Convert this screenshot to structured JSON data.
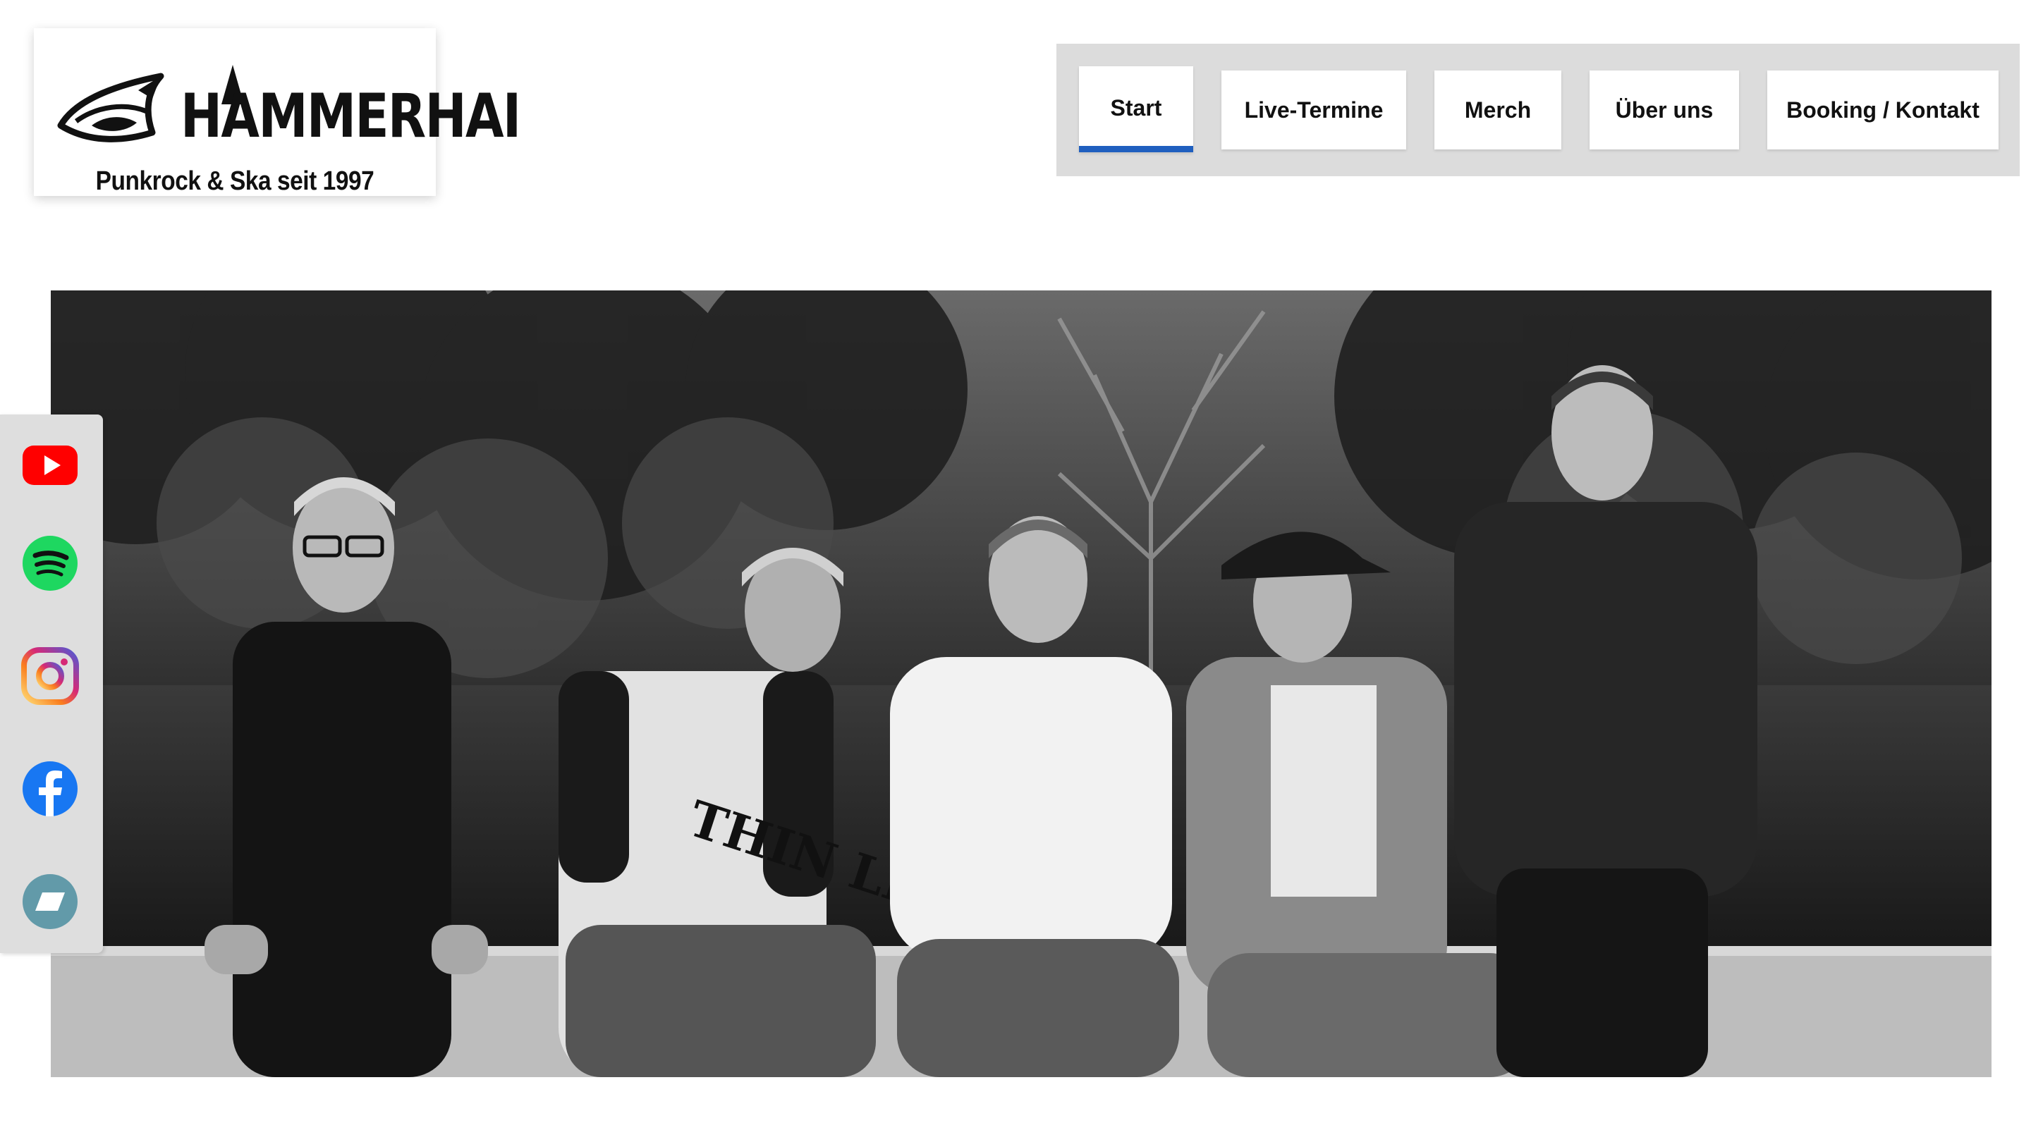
{
  "logo": {
    "wordmark": "HAMMERHAI",
    "tagline": "Punkrock & Ska seit 1997"
  },
  "nav": {
    "items": [
      {
        "label": "Start",
        "active": true
      },
      {
        "label": "Live-Termine",
        "active": false
      },
      {
        "label": "Merch",
        "active": false
      },
      {
        "label": "Über uns",
        "active": false
      },
      {
        "label": "Booking / Kontakt",
        "active": false
      }
    ],
    "active_color": "#1f5fbf"
  },
  "hero": {
    "image": "black-and-white band photo, five men seated on a wall by a pond"
  },
  "social": {
    "icons": [
      "youtube-icon",
      "spotify-icon",
      "instagram-icon",
      "facebook-icon",
      "bandcamp-icon"
    ]
  }
}
